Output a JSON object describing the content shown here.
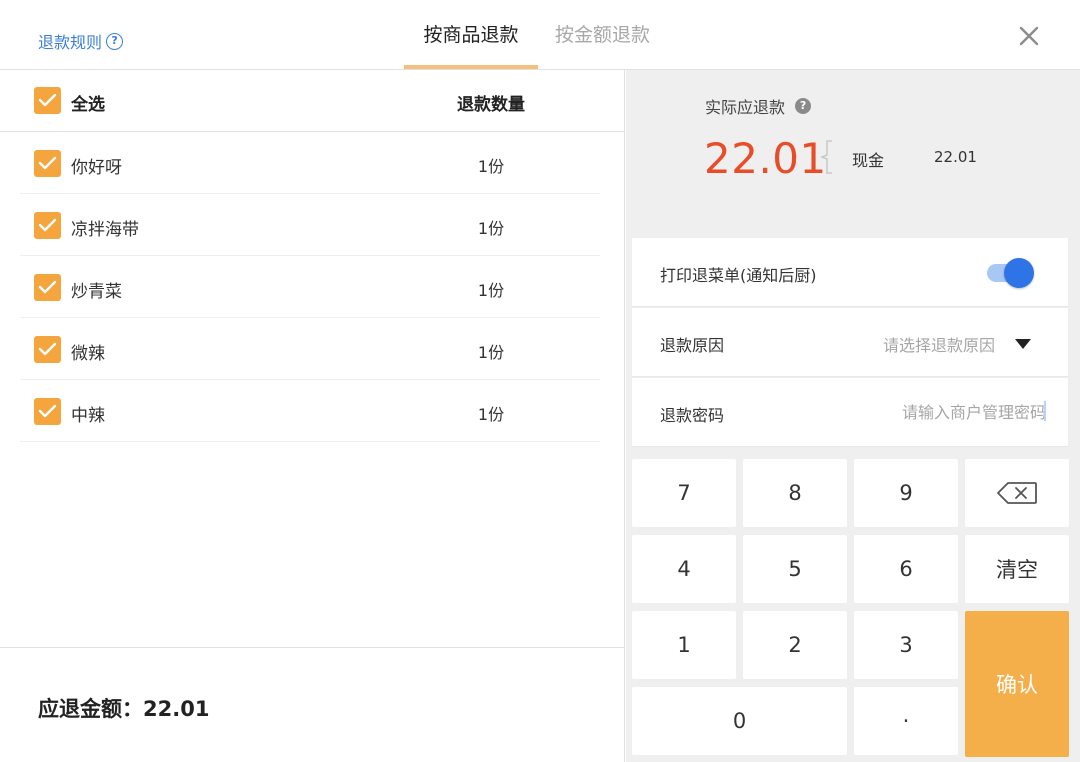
{
  "header": {
    "rules_link": "退款规则",
    "tabs": [
      {
        "label": "按商品退款",
        "active": true
      },
      {
        "label": "按金额退款",
        "active": false
      }
    ]
  },
  "list": {
    "select_all": "全选",
    "qty_header": "退款数量",
    "items": [
      {
        "name": "你好呀",
        "qty": "1份",
        "checked": true
      },
      {
        "name": "凉拌海带",
        "qty": "1份",
        "checked": true
      },
      {
        "name": "炒青菜",
        "qty": "1份",
        "checked": true
      },
      {
        "name": "微辣",
        "qty": "1份",
        "checked": true
      },
      {
        "name": "中辣",
        "qty": "1份",
        "checked": true
      }
    ]
  },
  "footer": {
    "amount_text": "应退金额：22.01"
  },
  "refund": {
    "actual_label": "实际应退款",
    "actual_amount": "22.01",
    "method_label": "现金",
    "method_value": "22.01",
    "print_label": "打印退菜单(通知后厨)",
    "print_enabled": true,
    "reason_label": "退款原因",
    "reason_placeholder": "请选择退款原因",
    "password_label": "退款密码",
    "password_placeholder": "请输入商户管理密码"
  },
  "keypad": {
    "k7": "7",
    "k8": "8",
    "k9": "9",
    "k4": "4",
    "k5": "5",
    "k6": "6",
    "k1": "1",
    "k2": "2",
    "k3": "3",
    "k0": "0",
    "dot": "·",
    "clear": "清空",
    "confirm": "确认"
  },
  "colors": {
    "accent_orange": "#f4a53d",
    "amount_red": "#e84d28",
    "link_blue": "#3d7fd9",
    "toggle_blue": "#2f74e6"
  }
}
